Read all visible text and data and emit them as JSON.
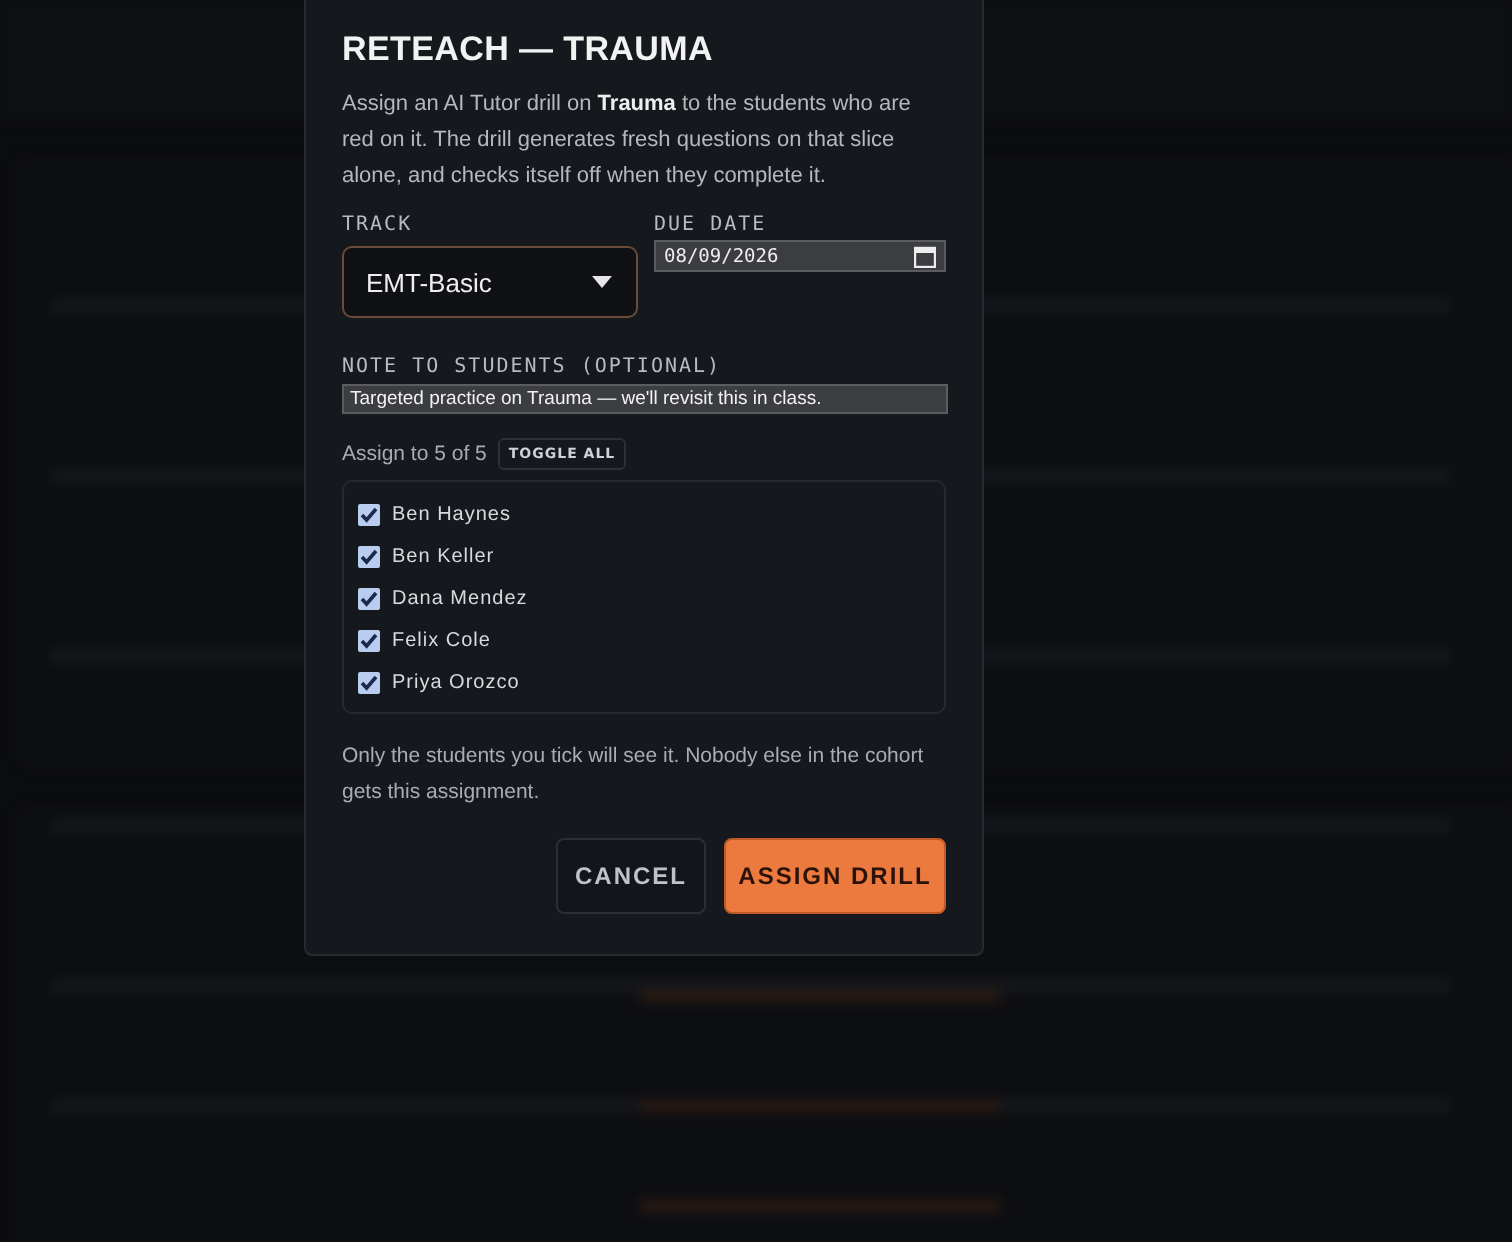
{
  "dialog": {
    "title": "RETEACH — TRAUMA",
    "description": "Assign an AI Tutor drill on **Trauma** to the students who are red on it. The drill generates fresh questions on that slice alone, and checks itself off when they complete it.",
    "track": {
      "label": "TRACK",
      "value": "EMT-Basic"
    },
    "due_date": {
      "label": "DUE DATE",
      "value": "08/09/2026"
    },
    "note": {
      "label": "NOTE TO STUDENTS (OPTIONAL)",
      "value": "Targeted practice on Trauma — we'll revisit this in class."
    },
    "assign_count": "Assign to 5 of 5",
    "toggle_all": "TOGGLE ALL",
    "students": [
      {
        "name": "Ben Haynes",
        "checked": true
      },
      {
        "name": "Ben Keller",
        "checked": true
      },
      {
        "name": "Dana Mendez",
        "checked": true
      },
      {
        "name": "Felix Cole",
        "checked": true
      },
      {
        "name": "Priya Orozco",
        "checked": true
      }
    ],
    "footnote": "Only the students you tick will see it. Nobody else in the cohort gets this assignment.",
    "buttons": [
      {
        "label": "CANCEL",
        "kind": "secondary"
      },
      {
        "label": "ASSIGN DRILL",
        "kind": "primary"
      }
    ]
  }
}
